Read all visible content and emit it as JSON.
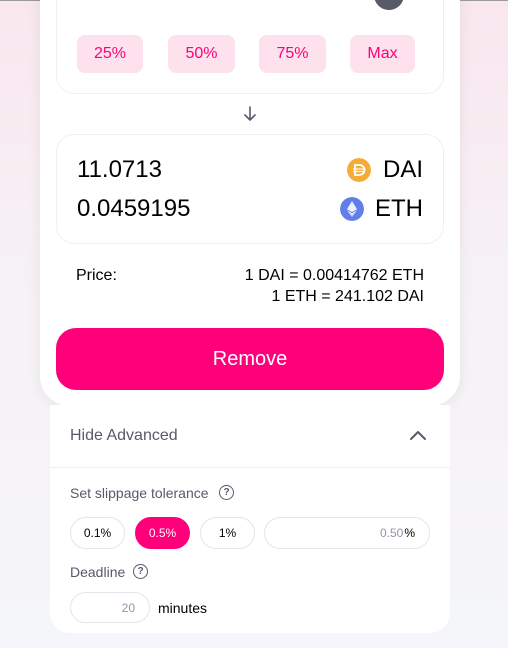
{
  "percent_buttons": [
    "25%",
    "50%",
    "75%",
    "Max"
  ],
  "output": {
    "token_a": {
      "amount": "11.0713",
      "symbol": "DAI",
      "icon": "dai-icon"
    },
    "token_b": {
      "amount": "0.0459195",
      "symbol": "ETH",
      "icon": "eth-icon"
    }
  },
  "price": {
    "label": "Price:",
    "line1": "1 DAI = 0.00414762 ETH",
    "line2": "1 ETH = 241.102 DAI"
  },
  "remove_label": "Remove",
  "advanced": {
    "toggle_label": "Hide Advanced",
    "slippage_label": "Set slippage tolerance",
    "slippage_options": [
      "0.1%",
      "0.5%",
      "1%"
    ],
    "slippage_selected": "0.5%",
    "slippage_custom_placeholder": "0.50",
    "slippage_unit": "%",
    "deadline_label": "Deadline",
    "deadline_placeholder": "20",
    "deadline_unit": "minutes",
    "help_icon": "?"
  },
  "colors": {
    "accent": "#ff007a",
    "accent_light": "#fde1ec"
  }
}
